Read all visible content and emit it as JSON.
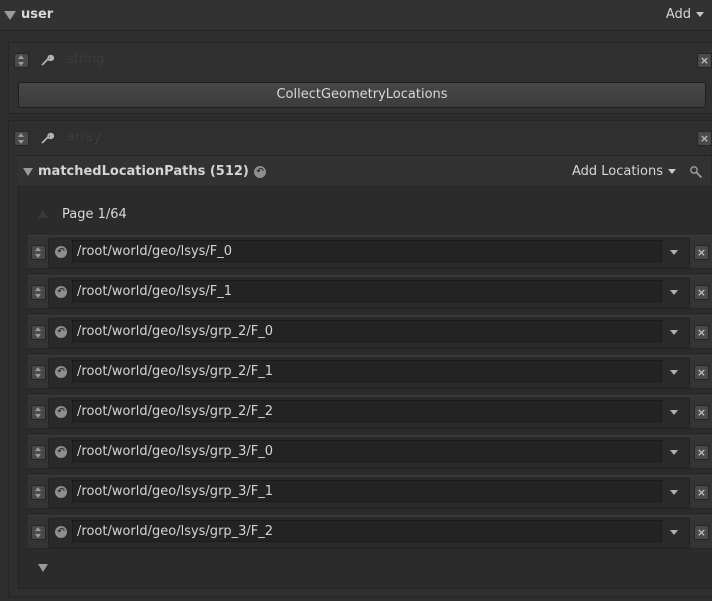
{
  "user_section": {
    "title": "user",
    "add_label": "Add"
  },
  "string_param": {
    "label": "string",
    "button_label": "CollectGeometryLocations"
  },
  "array_param": {
    "label": "array"
  },
  "matched_group": {
    "title": "matchedLocationPaths (512)",
    "add_locations_label": "Add Locations",
    "page_label": "Page 1/64",
    "rows": [
      {
        "path": "/root/world/geo/lsys/F_0"
      },
      {
        "path": "/root/world/geo/lsys/F_1"
      },
      {
        "path": "/root/world/geo/lsys/grp_2/F_0"
      },
      {
        "path": "/root/world/geo/lsys/grp_2/F_1"
      },
      {
        "path": "/root/world/geo/lsys/grp_2/F_2"
      },
      {
        "path": "/root/world/geo/lsys/grp_3/F_0"
      },
      {
        "path": "/root/world/geo/lsys/grp_3/F_1"
      },
      {
        "path": "/root/world/geo/lsys/grp_3/F_2"
      }
    ]
  },
  "icons": {
    "collapse": "triangle-down-icon",
    "drag": "drag-handle-icon",
    "remove": "close-icon",
    "edit": "wrench-icon",
    "reset": "revert-icon",
    "pick": "pick-icon"
  },
  "colors": {
    "background": "#2d2d2d",
    "field": "#232323",
    "text": "#d6d6d6"
  }
}
